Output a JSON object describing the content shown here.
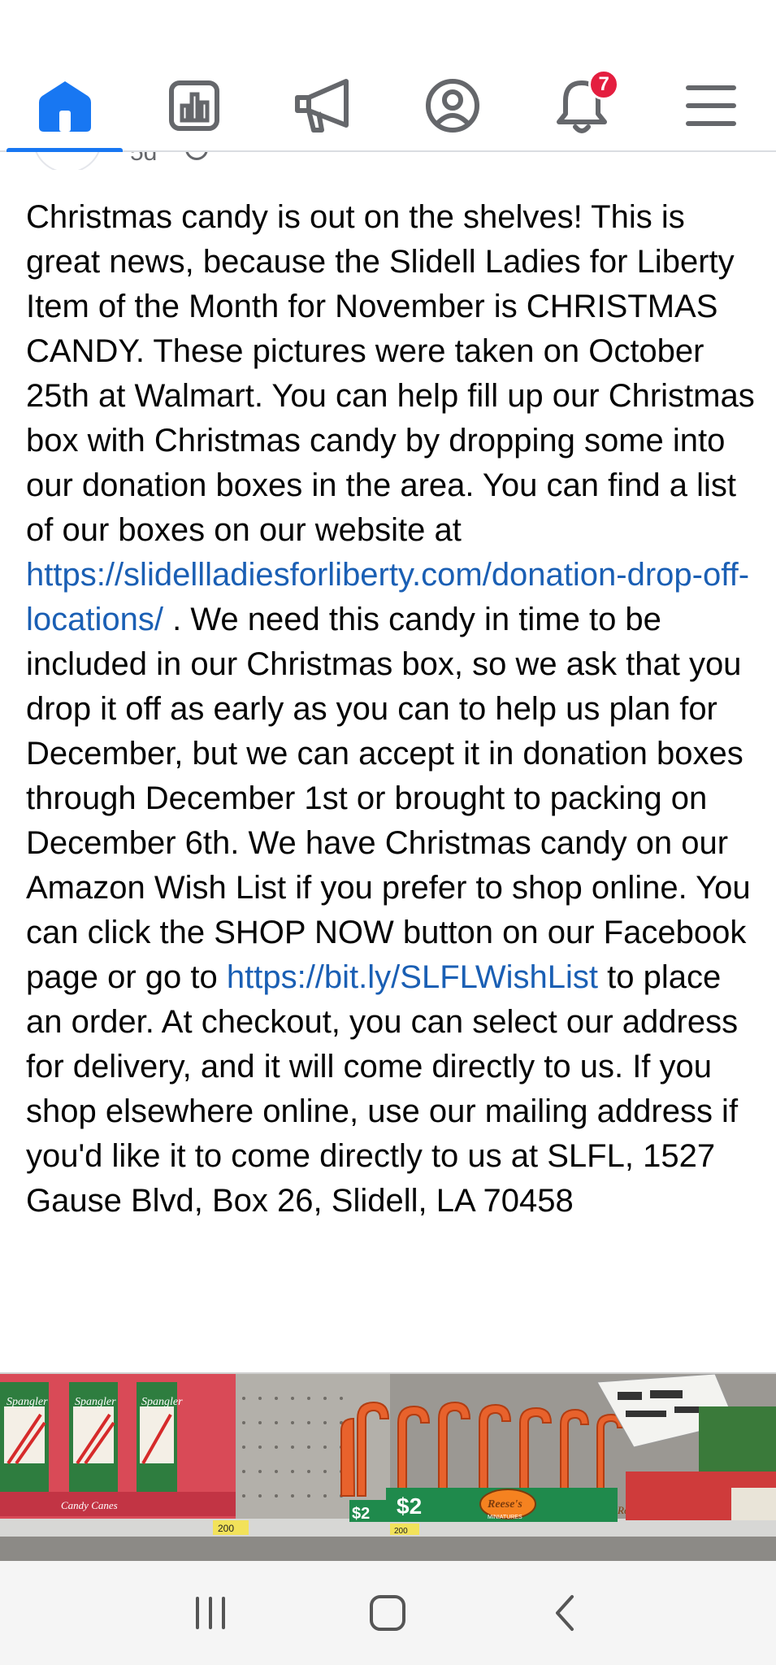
{
  "nav": {
    "items": [
      {
        "icon": "home-icon",
        "active": true
      },
      {
        "icon": "insights-icon",
        "active": false
      },
      {
        "icon": "megaphone-icon",
        "active": false
      },
      {
        "icon": "profile-icon",
        "active": false
      },
      {
        "icon": "bell-icon",
        "active": false,
        "badge": "7"
      },
      {
        "icon": "menu-icon",
        "active": false
      }
    ],
    "accent": "#1877f2",
    "badge_color": "#e41e3f"
  },
  "post": {
    "time_peek": "5d",
    "text_1": "Christmas candy is out on the shelves! This is great news, because the Slidell Ladies for Liberty Item of the Month for November is CHRISTMAS CANDY. These pictures were taken on October 25th at Walmart.  You can help fill up our Christmas box with Christmas candy by dropping some into our donation boxes in the area. You can find a list of our boxes on our website at",
    "link_1": "https://slidellladiesforliberty.com/donation-drop-off-locations/",
    "text_2": " . We need this candy in time to be included in our Christmas box, so we ask that you drop it off as early as you can to help us plan for December, but we can accept it in donation boxes through December 1st or brought to packing on December 6th. We have Christmas candy on our Amazon Wish List if you prefer to shop online. You can click the SHOP NOW button on our Facebook page or go to ",
    "link_2": "https://bit.ly/SLFLWishList",
    "text_3": " to place an order. At checkout, you can select our address for delivery, and it will come directly to us. If you shop elsewhere online, use our mailing address if you'd like it to come directly to us at SLFL, 1527 Gause Blvd, Box 26, Slidell, LA 70458",
    "link_color": "#1a5fb4"
  },
  "photo": {
    "labels": {
      "brand_1": "Spangler",
      "brand_2": "Spangler",
      "brand_3": "Spangler",
      "candy_canes": "Candy Canes",
      "price_1": "$2",
      "price_2": "$2",
      "reeses_1": "Reese's",
      "reeses_sub": "MINIATURES",
      "reeses_2": "Reese's",
      "tag_1": "200",
      "tag_2": "200"
    }
  },
  "system_nav": {
    "recent": "recent-apps-icon",
    "home": "home-square-icon",
    "back": "back-chevron-icon"
  }
}
